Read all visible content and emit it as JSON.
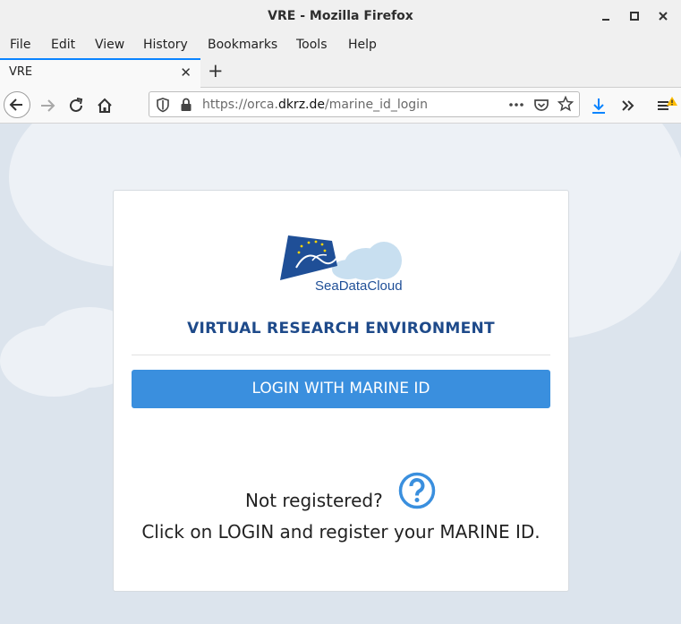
{
  "window": {
    "title": "VRE - Mozilla Firefox",
    "minimize_icon": "minimize-icon",
    "maximize_icon": "maximize-icon",
    "close_icon": "close-icon"
  },
  "menu": [
    "File",
    "Edit",
    "View",
    "History",
    "Bookmarks",
    "Tools",
    "Help"
  ],
  "tab": {
    "label": "VRE",
    "close": "✕",
    "new_tab": "+"
  },
  "toolbar": {
    "url_prefix": "https://orca.",
    "url_domain": "dkrz.de",
    "url_path": "/marine_id_login",
    "icons": [
      "back-icon",
      "forward-icon",
      "reload-icon",
      "home-icon",
      "shield-icon",
      "lock-icon",
      "more-icon",
      "pocket-icon",
      "bookmark-star-icon",
      "download-icon",
      "overflow-icon",
      "menu-icon"
    ]
  },
  "page": {
    "logo_text": "SeaDataCloud",
    "heading": "VIRTUAL RESEARCH ENVIRONMENT",
    "login_button": "LOGIN WITH MARINE ID",
    "not_registered": "Not registered?",
    "instructions": "Click on LOGIN and register your MARINE ID.",
    "accent_color": "#3a8fde",
    "heading_color": "#1e4a8a"
  }
}
